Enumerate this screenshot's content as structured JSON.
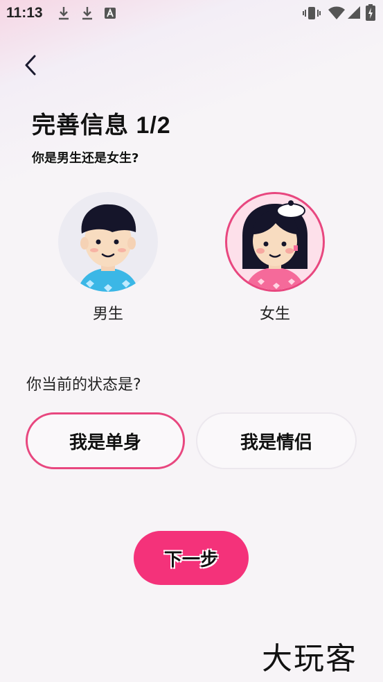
{
  "status_bar": {
    "time": "11:13"
  },
  "header": {
    "title": "完善信息 1/2",
    "subtitle": "你是男生还是女生?"
  },
  "gender": {
    "options": [
      {
        "label": "男生",
        "selected": false
      },
      {
        "label": "女生",
        "selected": true
      }
    ]
  },
  "relationship": {
    "question": "你当前的状态是?",
    "options": [
      {
        "label": "我是单身",
        "selected": true
      },
      {
        "label": "我是情侣",
        "selected": false
      }
    ]
  },
  "next_button": {
    "label": "下一步"
  },
  "watermark": {
    "text": "大玩客"
  },
  "colors": {
    "accent": "#f4327a",
    "selected_border": "#e8477f"
  }
}
